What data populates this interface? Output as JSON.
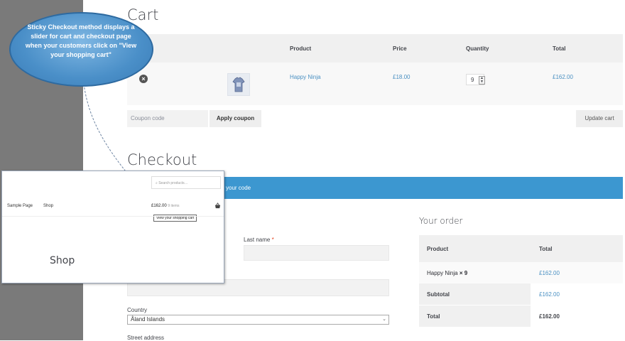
{
  "cart": {
    "title": "Cart",
    "headers": {
      "product": "Product",
      "price": "Price",
      "quantity": "Quantity",
      "total": "Total"
    },
    "row": {
      "remove": "×",
      "product": "Happy Ninja",
      "price": "£18.00",
      "quantity": "9",
      "total": "£162.00"
    },
    "coupon_placeholder": "Coupon code",
    "apply_label": "Apply coupon",
    "update_label": "Update cart"
  },
  "checkout": {
    "title": "Checkout",
    "notice_text": "your code",
    "last_name_label": "Last name",
    "required_mark": "*",
    "country_label": "Country",
    "country_value": "Åland Islands",
    "street_label": "Street address"
  },
  "order": {
    "title": "Your order",
    "headers": {
      "product": "Product",
      "total": "Total"
    },
    "item": {
      "name": "Happy Ninja",
      "qty": "× 9",
      "total": "£162.00"
    },
    "subtotal_label": "Subtotal",
    "subtotal_value": "£162.00",
    "total_label": "Total",
    "total_value": "£162.00"
  },
  "overlay": {
    "search_placeholder": "Search products…",
    "nav": [
      "Sample Page",
      "Shop"
    ],
    "cart_amount": "£162.00",
    "cart_items": "9 items",
    "tooltip": "View your shopping cart",
    "shop_heading": "Shop"
  },
  "callout": {
    "text": "Sticky Checkout method displays a slider for cart and checkout page when your customers click on \"View your shopping cart\""
  },
  "colors": {
    "accent": "#3c97d0",
    "link": "#4a90c2",
    "bubble": "#4a8fc8"
  },
  "icons": {
    "remove": "remove-circle-icon",
    "basket": "basket-icon",
    "search": "search-icon",
    "spinner": "spinner-icon",
    "chevron": "chevron-down-icon"
  }
}
